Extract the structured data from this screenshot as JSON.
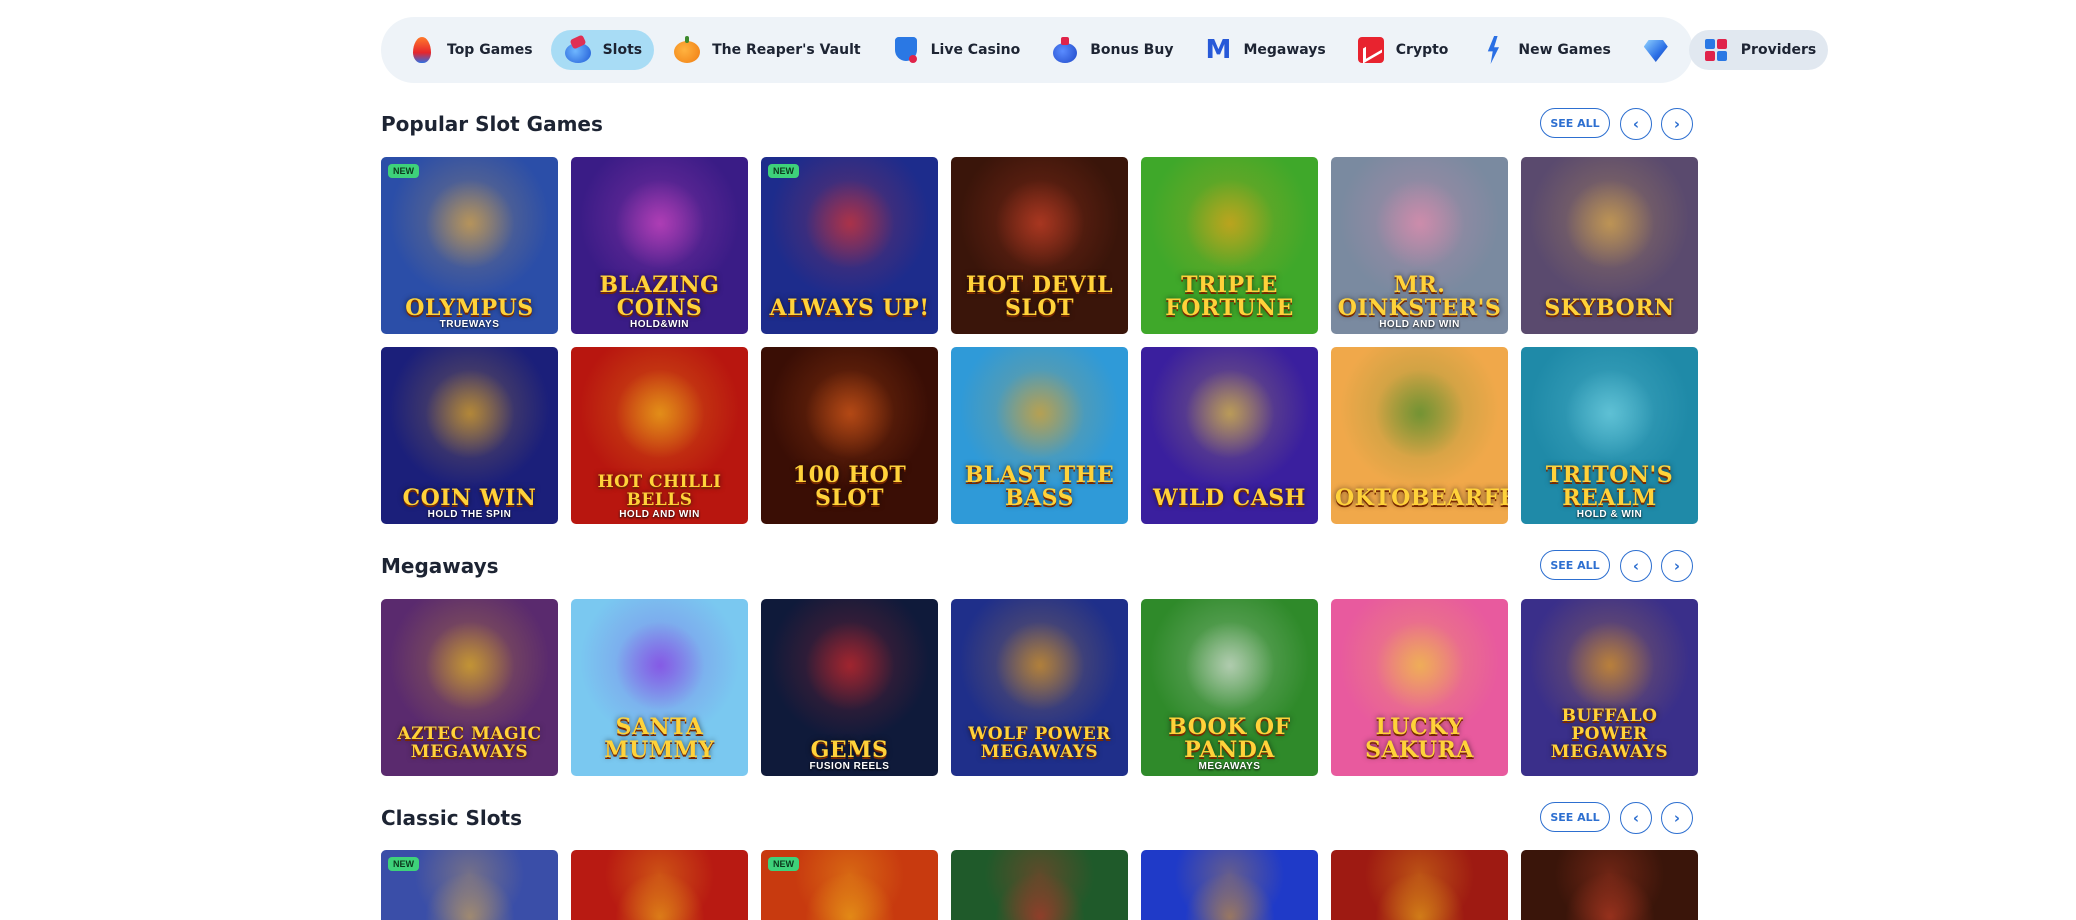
{
  "nav": {
    "items": [
      {
        "label": "Top Games",
        "icon": "flame-icon",
        "active": false
      },
      {
        "label": "Slots",
        "icon": "slot-machine-icon",
        "active": true
      },
      {
        "label": "The Reaper's Vault",
        "icon": "pumpkin-icon",
        "active": false
      },
      {
        "label": "Live Casino",
        "icon": "card-shield-icon",
        "active": false
      },
      {
        "label": "Bonus Buy",
        "icon": "money-bag-icon",
        "active": false
      },
      {
        "label": "Megaways",
        "icon": "megaways-m-icon",
        "active": false
      },
      {
        "label": "Crypto",
        "icon": "chart-icon",
        "active": false
      },
      {
        "label": "New Games",
        "icon": "lightning-icon",
        "active": false
      },
      {
        "label": "",
        "icon": "diamond-icon",
        "active": false
      },
      {
        "label": "Providers",
        "icon": "grid-icon",
        "active": false
      }
    ]
  },
  "controls": {
    "see_all": "SEE ALL",
    "prev": "‹",
    "next": "›"
  },
  "badges": {
    "new": "NEW"
  },
  "sections": [
    {
      "title": "Popular Slot Games",
      "games": [
        {
          "name": "Olympus",
          "sub": "TRUEWAYS",
          "new": true,
          "bg": "#2b4ea8",
          "accent": "#f2b23a"
        },
        {
          "name": "Blazing Coins",
          "sub": "HOLD&WIN",
          "new": false,
          "bg": "#3a1c86",
          "accent": "#e04cc9"
        },
        {
          "name": "Always Up!",
          "sub": "",
          "new": true,
          "bg": "#1d2c8c",
          "accent": "#e8352c"
        },
        {
          "name": "Hot Devil Slot",
          "sub": "",
          "new": false,
          "bg": "#3a150a",
          "accent": "#d8452a"
        },
        {
          "name": "Triple Fortune",
          "sub": "",
          "new": false,
          "bg": "#3fa82a",
          "accent": "#f0a319"
        },
        {
          "name": "Mr. Oinkster's",
          "sub": "HOLD AND WIN",
          "new": false,
          "bg": "#7a8aa0",
          "accent": "#f08cb0"
        },
        {
          "name": "Skyborn",
          "sub": "",
          "new": false,
          "bg": "#5a4a6e",
          "accent": "#e8b44a"
        },
        {
          "name": "Coin Win",
          "sub": "HOLD THE SPIN",
          "new": false,
          "bg": "#1b1f7a",
          "accent": "#f5b51c"
        },
        {
          "name": "Hot Chilli Bells",
          "sub": "HOLD AND WIN",
          "new": false,
          "bg": "#b8160f",
          "accent": "#f5c21c"
        },
        {
          "name": "100 Hot Slot",
          "sub": "",
          "new": false,
          "bg": "#3a0e05",
          "accent": "#e8621c"
        },
        {
          "name": "Blast the Bass",
          "sub": "",
          "new": false,
          "bg": "#2f9ad8",
          "accent": "#f0a319"
        },
        {
          "name": "Wild Cash",
          "sub": "",
          "new": false,
          "bg": "#3a1f9e",
          "accent": "#f2d13a"
        },
        {
          "name": "Oktobearfest",
          "sub": "",
          "new": false,
          "bg": "#f0a84a",
          "accent": "#3c8a2a"
        },
        {
          "name": "Triton's Realm",
          "sub": "HOLD & WIN",
          "new": false,
          "bg": "#1f8aa8",
          "accent": "#7ad8e8"
        }
      ]
    },
    {
      "title": "Megaways",
      "games": [
        {
          "name": "Aztec Magic Megaways",
          "sub": "",
          "new": false,
          "bg": "#5a2a6e",
          "accent": "#f0c21c"
        },
        {
          "name": "Santa Mummy",
          "sub": "",
          "new": false,
          "bg": "#7ac8f0",
          "accent": "#8a2ae0"
        },
        {
          "name": "Gems",
          "sub": "FUSION REELS",
          "new": false,
          "bg": "#0f1a3a",
          "accent": "#e02a2a"
        },
        {
          "name": "Wolf Power Megaways",
          "sub": "",
          "new": false,
          "bg": "#1f2f8a",
          "accent": "#f0a319"
        },
        {
          "name": "Book of Panda",
          "sub": "MEGAWAYS",
          "new": false,
          "bg": "#2f8a2a",
          "accent": "#e8e8e8"
        },
        {
          "name": "Lucky Sakura",
          "sub": "",
          "new": false,
          "bg": "#e85a9e",
          "accent": "#f2d13a"
        },
        {
          "name": "Buffalo Power Megaways",
          "sub": "",
          "new": false,
          "bg": "#3a2f8a",
          "accent": "#f0a319"
        }
      ]
    },
    {
      "title": "Classic Slots",
      "games": [
        {
          "name": "",
          "sub": "",
          "new": true,
          "bg": "#3a4ea8",
          "accent": "#e8b44a"
        },
        {
          "name": "",
          "sub": "",
          "new": false,
          "bg": "#b81a12",
          "accent": "#f5c21c"
        },
        {
          "name": "",
          "sub": "",
          "new": true,
          "bg": "#c83a0f",
          "accent": "#f5c21c"
        },
        {
          "name": "",
          "sub": "",
          "new": false,
          "bg": "#1f5a2a",
          "accent": "#e02a2a"
        },
        {
          "name": "",
          "sub": "",
          "new": false,
          "bg": "#1f3ac8",
          "accent": "#f0a319"
        },
        {
          "name": "",
          "sub": "",
          "new": false,
          "bg": "#9e1a12",
          "accent": "#f5c21c"
        },
        {
          "name": "",
          "sub": "",
          "new": false,
          "bg": "#3a150a",
          "accent": "#d8452a"
        }
      ]
    }
  ]
}
